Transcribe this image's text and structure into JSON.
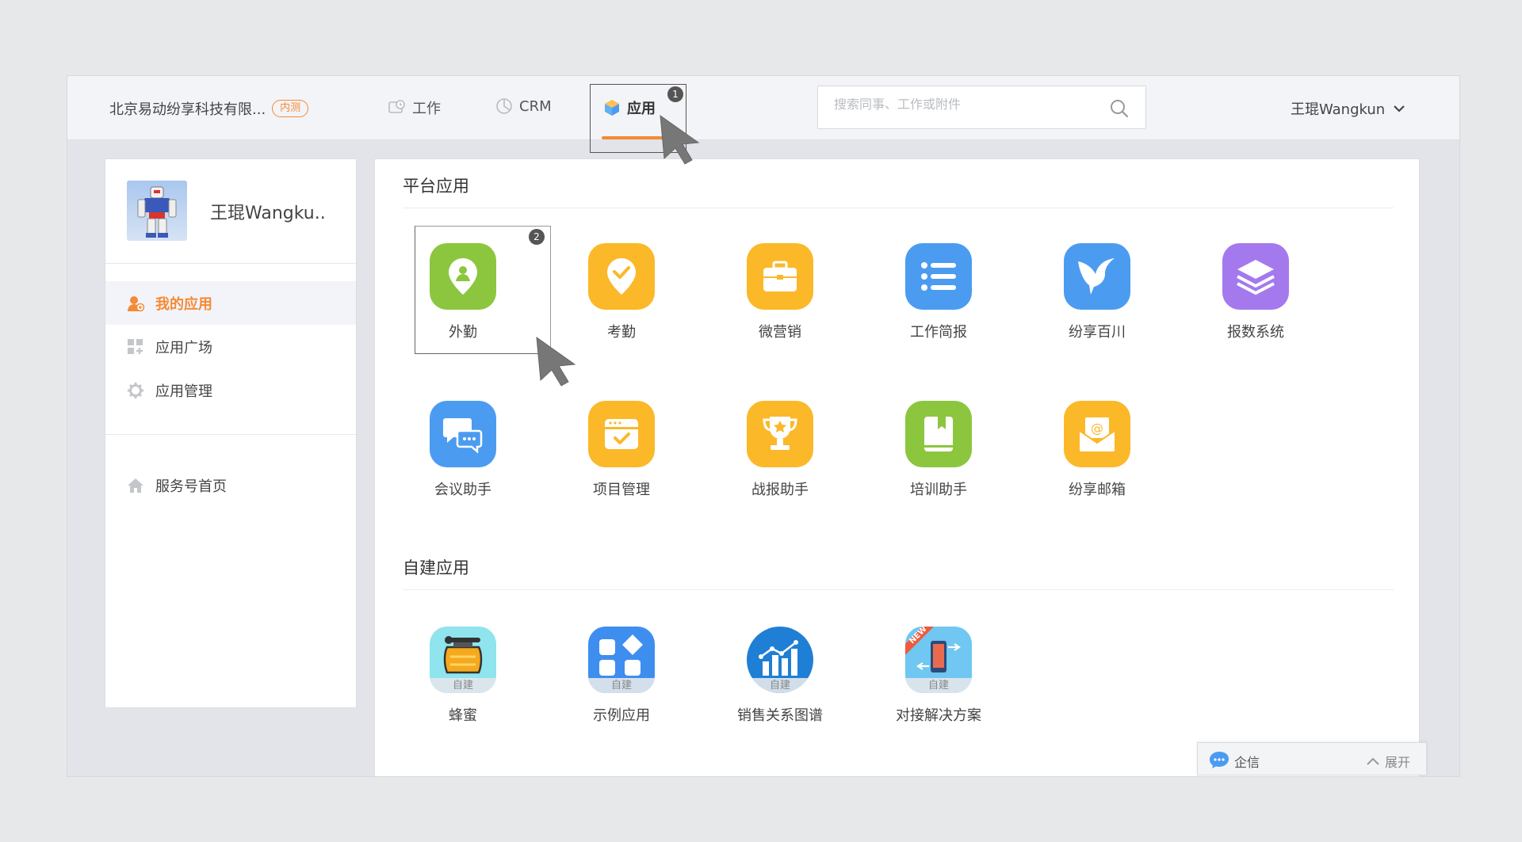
{
  "header": {
    "company": "北京易动纷享科技有限...",
    "company_badge": "内测",
    "nav": [
      {
        "label": "工作",
        "icon": "work-icon"
      },
      {
        "label": "CRM",
        "icon": "pie-chart-icon"
      },
      {
        "label": "应用",
        "icon": "cube-icon",
        "active": true
      }
    ],
    "search_placeholder": "搜索同事、工作或附件",
    "user": "王琨Wangkun",
    "step_marker": "1"
  },
  "sidebar": {
    "profile_name": "王琨Wangku..",
    "items": [
      {
        "label": "我的应用",
        "icon": "my-apps-icon",
        "active": true
      },
      {
        "label": "应用广场",
        "icon": "app-plaza-icon"
      },
      {
        "label": "应用管理",
        "icon": "gear-icon"
      }
    ],
    "service_home": "服务号首页"
  },
  "main": {
    "platform_title": "平台应用",
    "platform_apps": [
      {
        "label": "外勤",
        "icon": "location-pin-icon",
        "color": "#8cc63f"
      },
      {
        "label": "考勤",
        "icon": "check-pin-icon",
        "color": "#fbb829"
      },
      {
        "label": "微营销",
        "icon": "briefcase-icon",
        "color": "#fbb829"
      },
      {
        "label": "工作简报",
        "icon": "list-icon",
        "color": "#4b9cf0"
      },
      {
        "label": "纷享百川",
        "icon": "hummingbird-icon",
        "color": "#4b9cf0"
      },
      {
        "label": "报数系统",
        "icon": "layers-icon",
        "color": "#a479ee"
      },
      {
        "label": "会议助手",
        "icon": "chat-bubbles-icon",
        "color": "#4b9cf0"
      },
      {
        "label": "项目管理",
        "icon": "calendar-check-icon",
        "color": "#fbb829"
      },
      {
        "label": "战报助手",
        "icon": "trophy-icon",
        "color": "#fbb829"
      },
      {
        "label": "培训助手",
        "icon": "book-icon",
        "color": "#8cc63f"
      },
      {
        "label": "纷享邮箱",
        "icon": "mail-icon",
        "color": "#fbb829"
      }
    ],
    "custom_title": "自建应用",
    "custom_badge": "自建",
    "custom_apps": [
      {
        "label": "蜂蜜",
        "icon": "honey-icon"
      },
      {
        "label": "示例应用",
        "icon": "grid-shapes-icon"
      },
      {
        "label": "销售关系图谱",
        "icon": "bar-chart-icon"
      },
      {
        "label": "对接解决方案",
        "icon": "phone-sync-icon",
        "tag": "NEW"
      }
    ],
    "step_marker": "2"
  },
  "chat": {
    "label": "企信",
    "expand": "展开"
  }
}
